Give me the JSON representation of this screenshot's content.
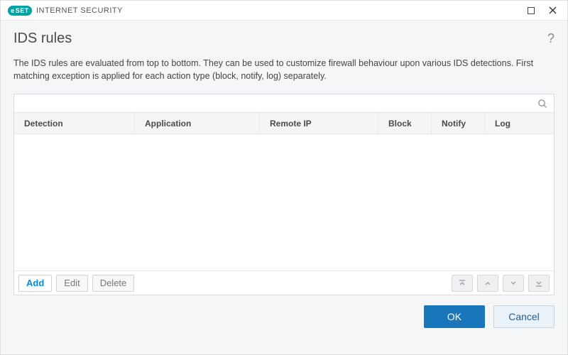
{
  "titlebar": {
    "product": "INTERNET SECURITY",
    "brand": "SET"
  },
  "header": {
    "title": "IDS rules"
  },
  "description": "The IDS rules are evaluated from top to bottom. They can be used to customize firewall behaviour upon various IDS detections. First matching exception is applied for each action type (block, notify, log) separately.",
  "columns": {
    "detection": "Detection",
    "application": "Application",
    "remote_ip": "Remote IP",
    "block": "Block",
    "notify": "Notify",
    "log": "Log"
  },
  "rows": [],
  "toolbar": {
    "add": "Add",
    "edit": "Edit",
    "delete": "Delete"
  },
  "search": {
    "placeholder": ""
  },
  "dialog": {
    "ok": "OK",
    "cancel": "Cancel"
  }
}
